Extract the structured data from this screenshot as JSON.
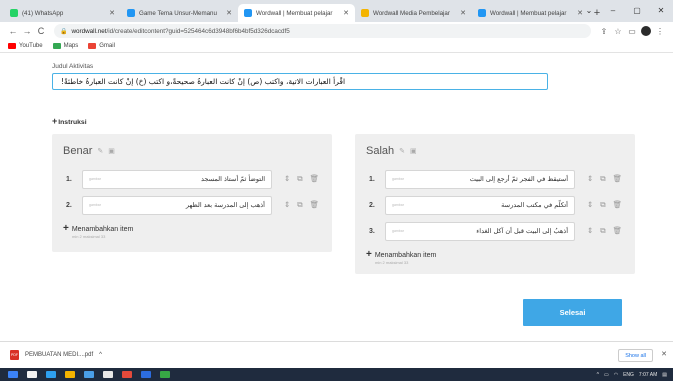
{
  "browser": {
    "tabs": [
      {
        "title": "(41) WhatsApp",
        "favicon_color": "#25d366",
        "active": false
      },
      {
        "title": "Game Tema Unsur-Memanu",
        "favicon_color": "#2196f3",
        "active": false
      },
      {
        "title": "Wordwall | Membuat pelajar",
        "favicon_color": "#2196f3",
        "active": true
      },
      {
        "title": "Wordwall Media Pembelajar",
        "favicon_color": "#f4b400",
        "active": false
      },
      {
        "title": "Wordwall | Membuat pelajar",
        "favicon_color": "#2196f3",
        "active": false
      }
    ],
    "new_tab_label": "+",
    "window_controls": {
      "dropdown": "⌄",
      "minimize": "–",
      "maximize": "▢",
      "close": "✕"
    },
    "address": {
      "host": "wordwall.net",
      "path": "/id/create/editcontent?guid=525464c6d3948bf6b4bf5d326dcacdf5"
    },
    "nav": {
      "back": "←",
      "forward": "→",
      "reload": "C"
    },
    "bookmarks": [
      {
        "label": "YouTube",
        "color": "#ff0000"
      },
      {
        "label": "Maps",
        "color": "#34a853"
      },
      {
        "label": "Gmail",
        "color": "#ea4335"
      }
    ]
  },
  "editor": {
    "title_label": "Judul Aktivitas",
    "title_value": "اقْرأ العبارات الاتية، واكتب (ص) إنْ كانت العبارةُ صحيحةً،و اكتب (خ) إنْ كانت العبارةُ خاطئةً!",
    "instruction_link": "Instruksi",
    "instruction_plus": "+",
    "groups": [
      {
        "title": "Benar",
        "items": [
          {
            "num": "1.",
            "text": "التوضأ ثمّ أستاذ المسجد",
            "thumb": "gambar"
          },
          {
            "num": "2.",
            "text": "أذهب إلى المدرسة بعد الظهر",
            "thumb": "gambar"
          }
        ],
        "add_label": "Menambahkan item",
        "add_meta": "min 2   maksimal 33"
      },
      {
        "title": "Salah",
        "items": [
          {
            "num": "1.",
            "text": "أستيقظ في الفجر ثمّ أرجع إلى البيت",
            "thumb": "gambar"
          },
          {
            "num": "2.",
            "text": "أتكلّم في مكتب المدرسة",
            "thumb": "gambar"
          },
          {
            "num": "3.",
            "text": "أذهبُ إلى البيت قبل أن آكل الغداء",
            "thumb": "gambar"
          }
        ],
        "add_label": "Menambahkan item",
        "add_meta": "min 2   maksimal 33"
      }
    ],
    "done_button": "Selesai"
  },
  "downloads": {
    "file": "PEMBUATAN MEDI....pdf",
    "chevron": "^",
    "show_all": "Show all",
    "close": "✕"
  },
  "taskbar": {
    "apps": [
      "#3b82f6",
      "#f2f2f2",
      "#2ea0f0",
      "#f5b400",
      "#4a9fe8",
      "#e8e8e8",
      "#e44a3b",
      "#2c6de0",
      "#37a845"
    ],
    "tray": {
      "lang": "ENG",
      "time": "7:07 AM"
    }
  }
}
